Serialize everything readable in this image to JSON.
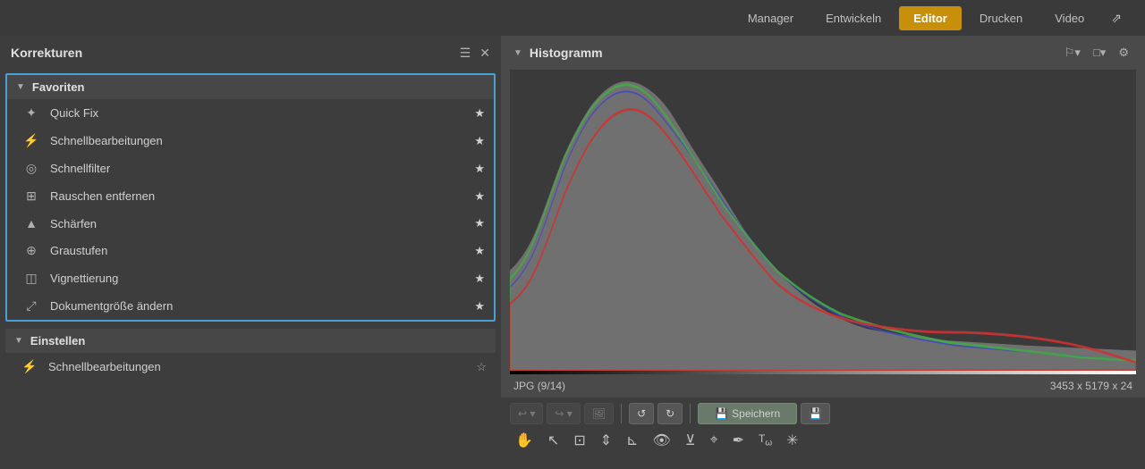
{
  "topnav": {
    "items": [
      {
        "id": "manager",
        "label": "Manager",
        "active": false
      },
      {
        "id": "entwickeln",
        "label": "Entwickeln",
        "active": false
      },
      {
        "id": "editor",
        "label": "Editor",
        "active": true
      },
      {
        "id": "drucken",
        "label": "Drucken",
        "active": false
      },
      {
        "id": "video",
        "label": "Video",
        "active": false
      }
    ],
    "export_icon": "↗"
  },
  "leftPanel": {
    "title": "Korrekturen",
    "menu_icon": "☰",
    "close_icon": "✕",
    "favorites": {
      "title": "Favoriten",
      "items": [
        {
          "id": "quick-fix",
          "icon": "✦",
          "label": "Quick Fix"
        },
        {
          "id": "schnellbearbeitungen",
          "icon": "⚡",
          "label": "Schnellbearbeitungen"
        },
        {
          "id": "schnellfilter",
          "icon": "◎",
          "label": "Schnellfilter"
        },
        {
          "id": "rauschen-entfernen",
          "icon": "⊞",
          "label": "Rauschen entfernen"
        },
        {
          "id": "schaerfen",
          "icon": "▲",
          "label": "Schärfen"
        },
        {
          "id": "graustufen",
          "icon": "⊕",
          "label": "Graustufen"
        },
        {
          "id": "vignettierung",
          "icon": "◫",
          "label": "Vignettierung"
        },
        {
          "id": "dokumentgroesse",
          "icon": "⤢",
          "label": "Dokumentgröße ändern"
        }
      ]
    },
    "einstellen": {
      "title": "Einstellen",
      "sub_items": [
        {
          "id": "schnellbearbeitungen-e",
          "icon": "⚡",
          "label": "Schnellbearbeitungen"
        }
      ]
    }
  },
  "histogram": {
    "title": "Histogramm",
    "file_type": "JPG",
    "file_index": "(9/14)",
    "dimensions": "3453 x 5179 x 24"
  },
  "toolbar": {
    "undo_label": "↩",
    "redo_label": "↪",
    "image_icon": "🖼",
    "rotate_left": "↺",
    "rotate_right": "↻",
    "save_label": "Speichern",
    "save_as_icon": "💾",
    "tools": [
      {
        "id": "hand",
        "symbol": "✋"
      },
      {
        "id": "select",
        "symbol": "↖"
      },
      {
        "id": "crop",
        "symbol": "⊡"
      },
      {
        "id": "straighten",
        "symbol": "⇕"
      },
      {
        "id": "selection",
        "symbol": "⊾"
      },
      {
        "id": "eye",
        "symbol": "👁"
      },
      {
        "id": "levels",
        "symbol": "⊻"
      },
      {
        "id": "heal",
        "symbol": "⌖"
      },
      {
        "id": "brush",
        "symbol": "✒"
      },
      {
        "id": "text",
        "symbol": "Tω"
      },
      {
        "id": "effects",
        "symbol": "❊"
      }
    ]
  }
}
